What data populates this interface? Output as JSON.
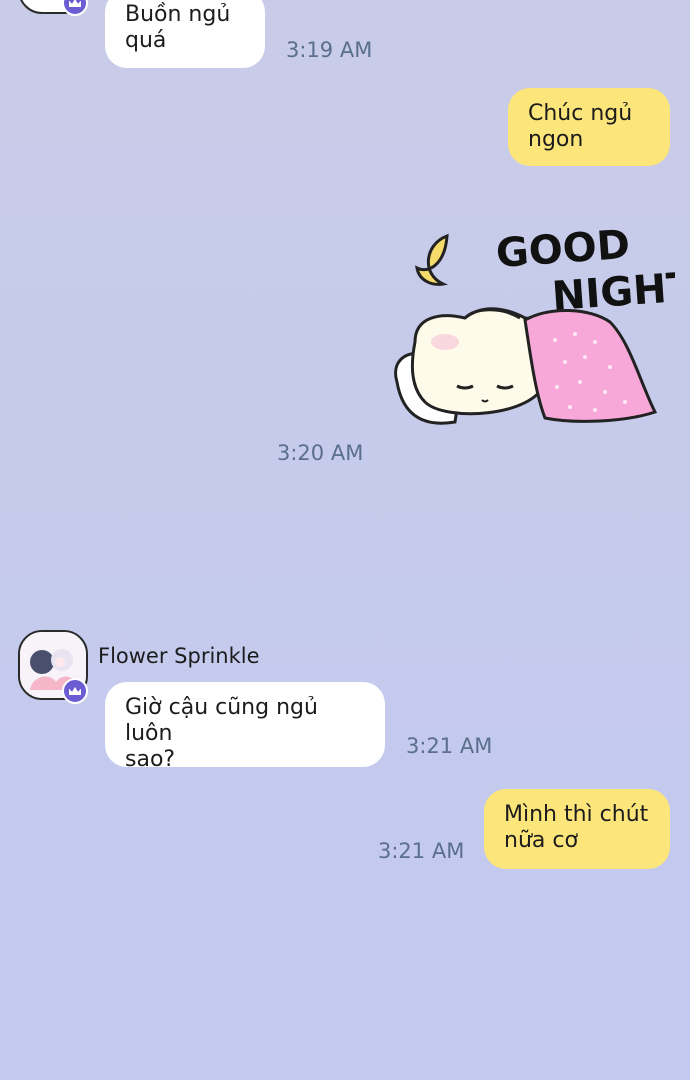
{
  "messages": [
    {
      "id": "m1",
      "text": "Buồn ngủ\nquá",
      "time": "3:19 AM"
    },
    {
      "id": "m2",
      "text": "Chúc ngủ\nngon"
    },
    {
      "id": "m3",
      "sticker_text": [
        "GOOD",
        "NIGHT"
      ],
      "time": "3:20 AM"
    },
    {
      "id": "m4",
      "sender": "Flower Sprinkle",
      "text": "Giờ cậu cũng ngủ luôn\nsao?",
      "time": "3:21 AM"
    },
    {
      "id": "m5",
      "text": "Mình thì chút\nnữa cơ",
      "time": "3:21 AM"
    }
  ],
  "colors": {
    "incoming_bubble": "#ffffff",
    "outgoing_bubble": "#fce57a",
    "time_text": "#5a6f8c",
    "badge": "#6c5dd3"
  },
  "icons": {
    "sender_badge": "crown-icon",
    "sticker": "sleeping-bunny-sticker"
  }
}
